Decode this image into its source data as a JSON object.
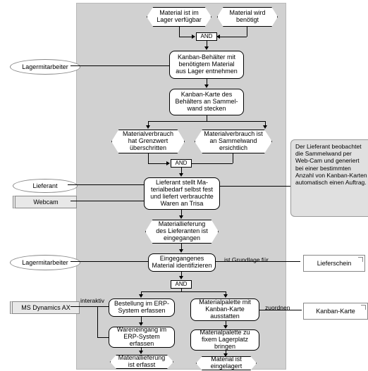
{
  "events": {
    "e1": "Material ist im Lager verfügbar",
    "e2": "Material wird benötigt",
    "e3": "Materialverbrauch hat Grenzwert überschritten",
    "e4": "Materialverbrauch ist an Sammelwand ersichtlich",
    "e5": "Materiallieferung des Lieferanten ist eingegangen",
    "e6": "Materiallieferung ist erfasst",
    "e7": "Material ist eingelagert"
  },
  "functions": {
    "f1": "Kanban-Behälter mit benötigtem Material aus Lager entnehmen",
    "f2": "Kanban-Karte des Behälters an Sammel-wand stecken",
    "f3": "Lieferant stellt Ma-terialbedarf selbst fest und liefert verbrauchte Waren an Trisa",
    "f4": "Eingegangenes Material identifizieren",
    "f5": "Bestellung im ERP-System erfassen",
    "f6": "Wareneingang im ERP-System erfassen",
    "f7": "Materialpalette mit Kanban-Karte ausstatten",
    "f8": "Materialpalette zu fixem Lagerplatz bringen"
  },
  "connectors": {
    "and": "AND"
  },
  "roles": {
    "lagermitarbeiter": "Lagermitarbeiter",
    "lieferant": "Lieferant"
  },
  "systems": {
    "webcam": "Webcam",
    "erp": "MS Dynamics AX"
  },
  "documents": {
    "lieferschein": "Lieferschein",
    "kanbankarte": "Kanban-Karte"
  },
  "labels": {
    "grundlage": "ist Grundlage für",
    "zuordnen": "zuordnen",
    "interaktiv": "interaktiv"
  },
  "note": "Der Lieferant beobachtet die Sammelwand per Web-Cam und generiert bei einer bestimmten Anzahl von Kanban-Karten automatisch einen Auftrag."
}
